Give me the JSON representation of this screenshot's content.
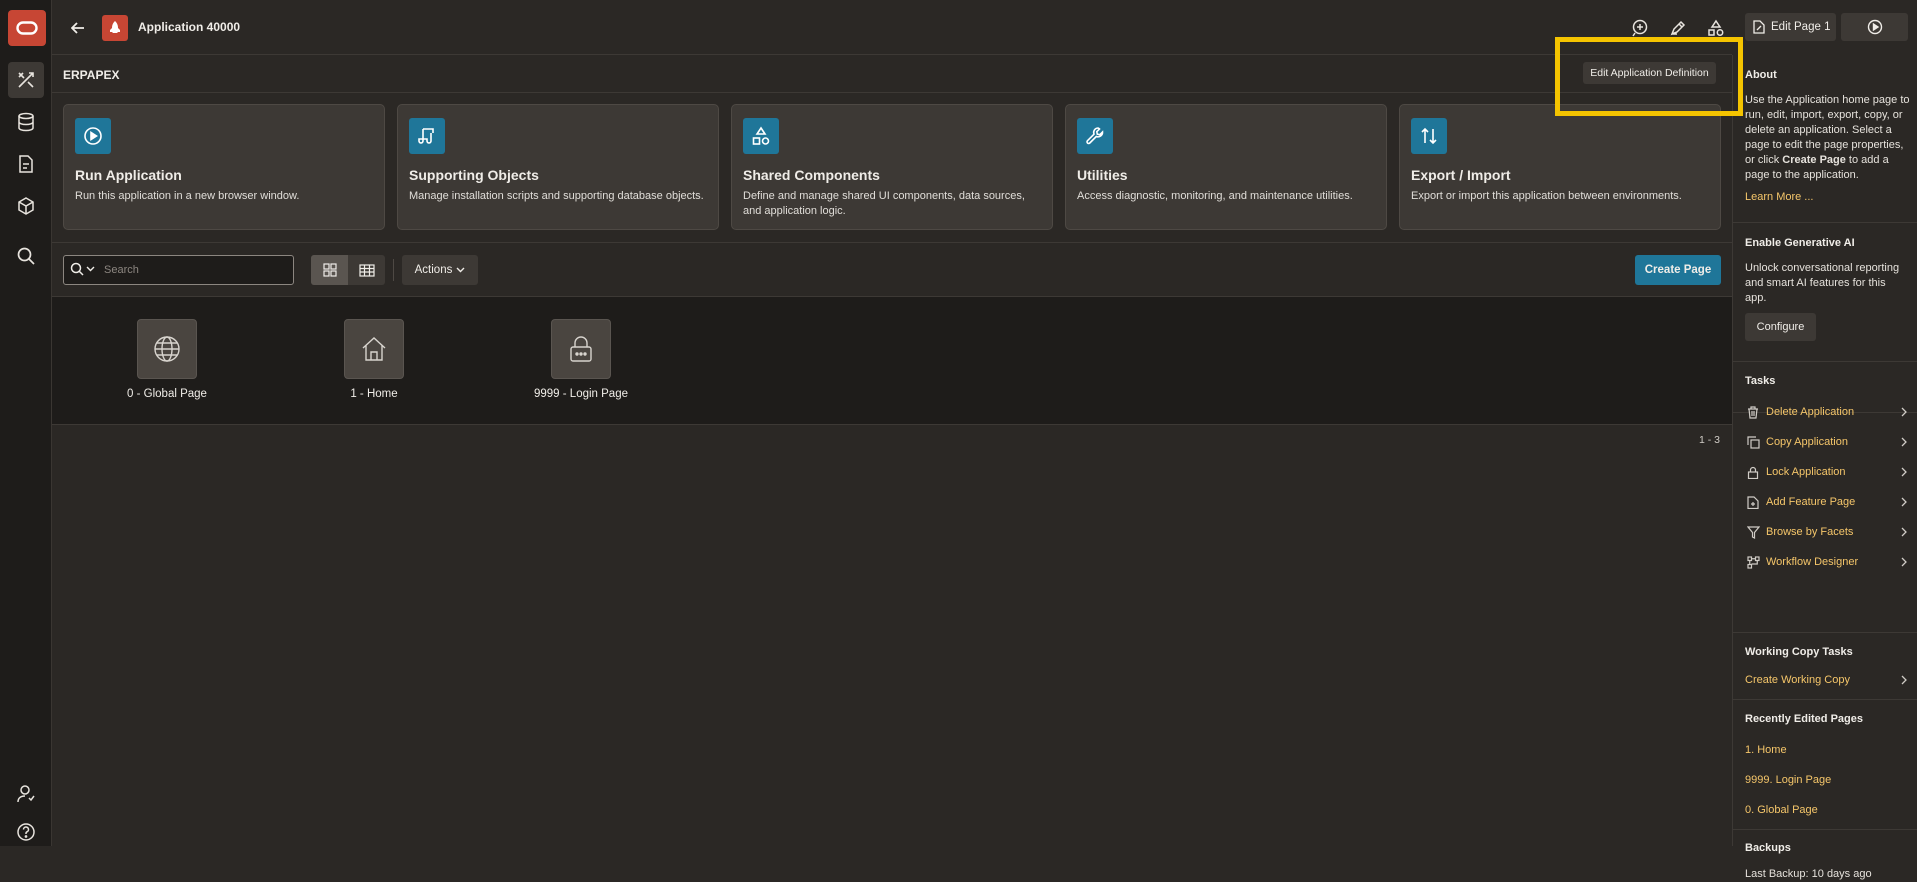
{
  "header": {
    "app_title": "Application 40000",
    "edit_page_label": "Edit Page 1"
  },
  "subheader": {
    "title": "ERPAPEX",
    "edit_app_def_label": "Edit Application Definition"
  },
  "cards": [
    {
      "title": "Run Application",
      "desc": "Run this application in a new browser window."
    },
    {
      "title": "Supporting Objects",
      "desc": "Manage installation scripts and supporting database objects."
    },
    {
      "title": "Shared Components",
      "desc": "Define and manage shared UI components, data sources, and application logic."
    },
    {
      "title": "Utilities",
      "desc": "Access diagnostic, monitoring, and maintenance utilities."
    },
    {
      "title": "Export / Import",
      "desc": "Export or import this application between environments."
    }
  ],
  "toolbar": {
    "search_placeholder": "Search",
    "actions_label": "Actions",
    "create_page_label": "Create Page"
  },
  "pages": [
    {
      "label": "0 - Global Page",
      "icon": "globe-icon"
    },
    {
      "label": "1 - Home",
      "icon": "home-icon"
    },
    {
      "label": "9999 - Login Page",
      "icon": "lock-icon"
    }
  ],
  "page_count": "1 - 3",
  "sidebar": {
    "about": {
      "heading": "About",
      "text_1": "Use the Application home page to run, edit, import, export, copy, or delete an application. Select a page to edit the page properties, or click ",
      "text_bold": "Create Page",
      "text_2": " to add a page to the application.",
      "learn_more": "Learn More ..."
    },
    "genai": {
      "heading": "Enable Generative AI",
      "text": "Unlock conversational reporting and smart AI features for this app.",
      "configure_label": "Configure"
    },
    "tasks": {
      "heading": "Tasks",
      "items": [
        {
          "label": "Delete Application",
          "icon": "trash-icon"
        },
        {
          "label": "Copy Application",
          "icon": "copy-icon"
        },
        {
          "label": "Lock Application",
          "icon": "lock-icon"
        },
        {
          "label": "Add Feature Page",
          "icon": "add-page-icon"
        },
        {
          "label": "Browse by Facets",
          "icon": "filter-icon"
        },
        {
          "label": "Workflow Designer",
          "icon": "workflow-icon"
        }
      ]
    },
    "working_copy": {
      "heading": "Working Copy Tasks",
      "items": [
        {
          "label": "Create Working Copy"
        }
      ]
    },
    "recent": {
      "heading": "Recently Edited Pages",
      "items": [
        "1. Home",
        "9999. Login Page",
        "0. Global Page"
      ]
    },
    "backups": {
      "heading": "Backups",
      "text": "Last Backup: 10 days ago"
    }
  },
  "colors": {
    "accent_blue": "#1f7699",
    "brand_red": "#c74634",
    "link_gold": "#f5c66a",
    "highlight_yellow": "#f5c400"
  }
}
